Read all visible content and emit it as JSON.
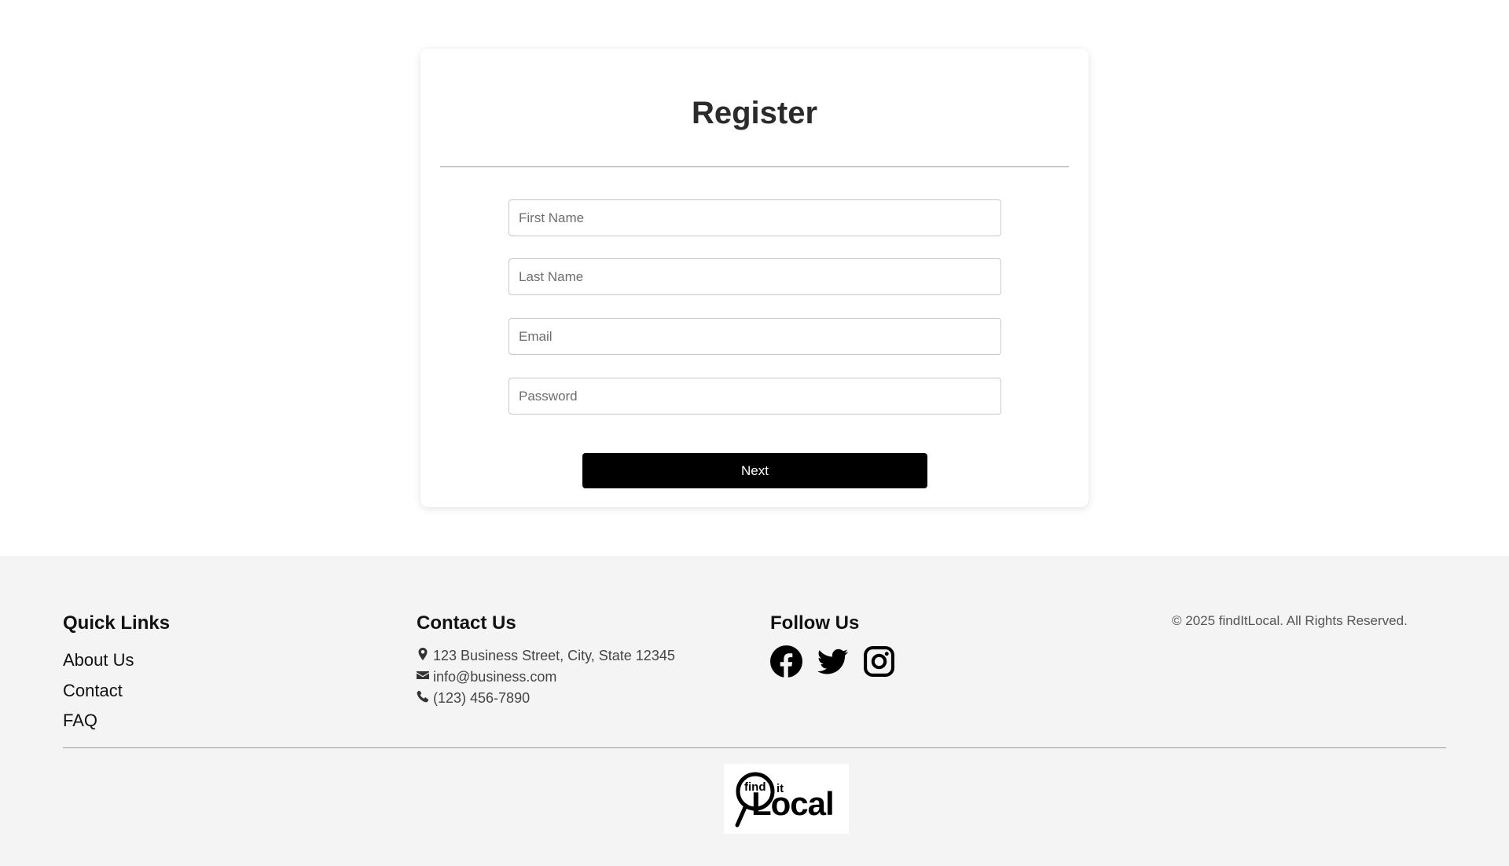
{
  "form": {
    "title": "Register",
    "fields": {
      "first_name": {
        "placeholder": "First Name",
        "value": ""
      },
      "last_name": {
        "placeholder": "Last Name",
        "value": ""
      },
      "email": {
        "placeholder": "Email",
        "value": ""
      },
      "password": {
        "placeholder": "Password",
        "value": ""
      }
    },
    "next_label": "Next"
  },
  "footer": {
    "quick_links": {
      "heading": "Quick Links",
      "items": [
        "About Us",
        "Contact",
        "FAQ"
      ]
    },
    "contact": {
      "heading": "Contact Us",
      "address": "123 Business Street, City, State 12345",
      "email": "info@business.com",
      "phone": "(123) 456-7890",
      "icons": [
        "map-marker-icon",
        "envelope-icon",
        "phone-icon"
      ]
    },
    "follow": {
      "heading": "Follow Us",
      "icons": [
        "facebook-icon",
        "twitter-icon",
        "instagram-icon"
      ]
    },
    "copyright": "© 2025 findItLocal. All Rights Reserved.",
    "logo": {
      "text": "find it Local"
    }
  },
  "colors": {
    "page_bg": "#ffffff",
    "footer_bg": "#f4f4f4",
    "button_bg": "#000000",
    "button_text": "#ffffff"
  }
}
